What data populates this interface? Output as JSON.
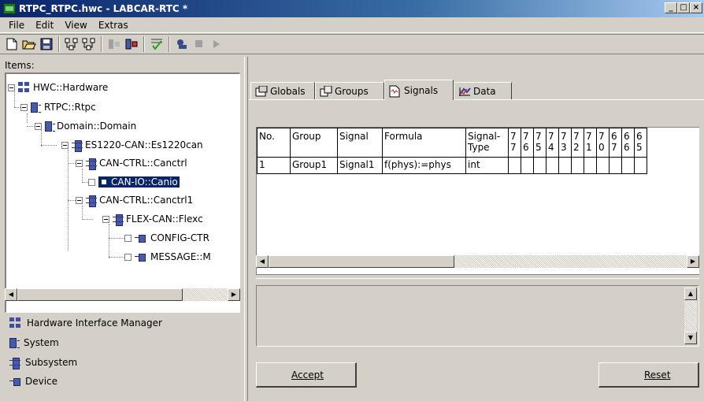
{
  "window": {
    "title": "RTPC_RTPC.hwc - LABCAR-RTC *",
    "buttons": [
      "_",
      "□",
      "×"
    ]
  },
  "menu": [
    "File",
    "Edit",
    "View",
    "Extras"
  ],
  "toolbar": {
    "icons": [
      "new-icon",
      "open-icon",
      "save-icon",
      "tree-expand-icon",
      "tree-collapse-icon",
      "disabled-icon",
      "import-icon",
      "check-icon",
      "connect-icon",
      "stop-icon",
      "play-icon"
    ]
  },
  "left": {
    "items_label": "Items:",
    "tree": [
      {
        "label": "HWC::Hardware",
        "icon": "hw"
      },
      {
        "label": "RTPC::Rtpc",
        "icon": "sys"
      },
      {
        "label": "Domain::Domain",
        "icon": "sys"
      },
      {
        "label": "ES1220-CAN::Es1220can",
        "icon": "sub"
      },
      {
        "label": "CAN-CTRL::Canctrl",
        "icon": "sub"
      },
      {
        "label": "CAN-IO::Canio",
        "icon": "dev",
        "selected": true
      },
      {
        "label": "CAN-CTRL::Canctrl1",
        "icon": "sub"
      },
      {
        "label": "FLEX-CAN::Flexc",
        "icon": "sub"
      },
      {
        "label": "CONFIG-CTR",
        "icon": "dev"
      },
      {
        "label": "MESSAGE::M",
        "icon": "dev"
      }
    ],
    "legend": [
      {
        "label": "Hardware Interface Manager",
        "icon": "hw"
      },
      {
        "label": "System",
        "icon": "sys"
      },
      {
        "label": "Subsystem",
        "icon": "sub"
      },
      {
        "label": "Device",
        "icon": "dev"
      }
    ]
  },
  "tabs": [
    {
      "label": "Globals",
      "active": false
    },
    {
      "label": "Groups",
      "active": false
    },
    {
      "label": "Signals",
      "active": true
    },
    {
      "label": "Data",
      "active": false
    }
  ],
  "grid": {
    "headers": [
      "No.",
      "Group",
      "Signal",
      "Formula",
      "Signal-\nType",
      "7\n7",
      "7\n6",
      "7\n5",
      "7\n4",
      "7\n3",
      "7\n2",
      "7\n1",
      "7\n0",
      "6\n7",
      "6\n6",
      "6\n5"
    ],
    "rows": [
      [
        "1",
        "Group1",
        "Signal1",
        "f(phys):=phys",
        "int",
        "",
        "",
        "",
        "",
        "",
        "",
        "",
        "",
        "",
        "",
        ""
      ]
    ]
  },
  "buttons": {
    "accept": "Accept",
    "reset": "Reset"
  }
}
